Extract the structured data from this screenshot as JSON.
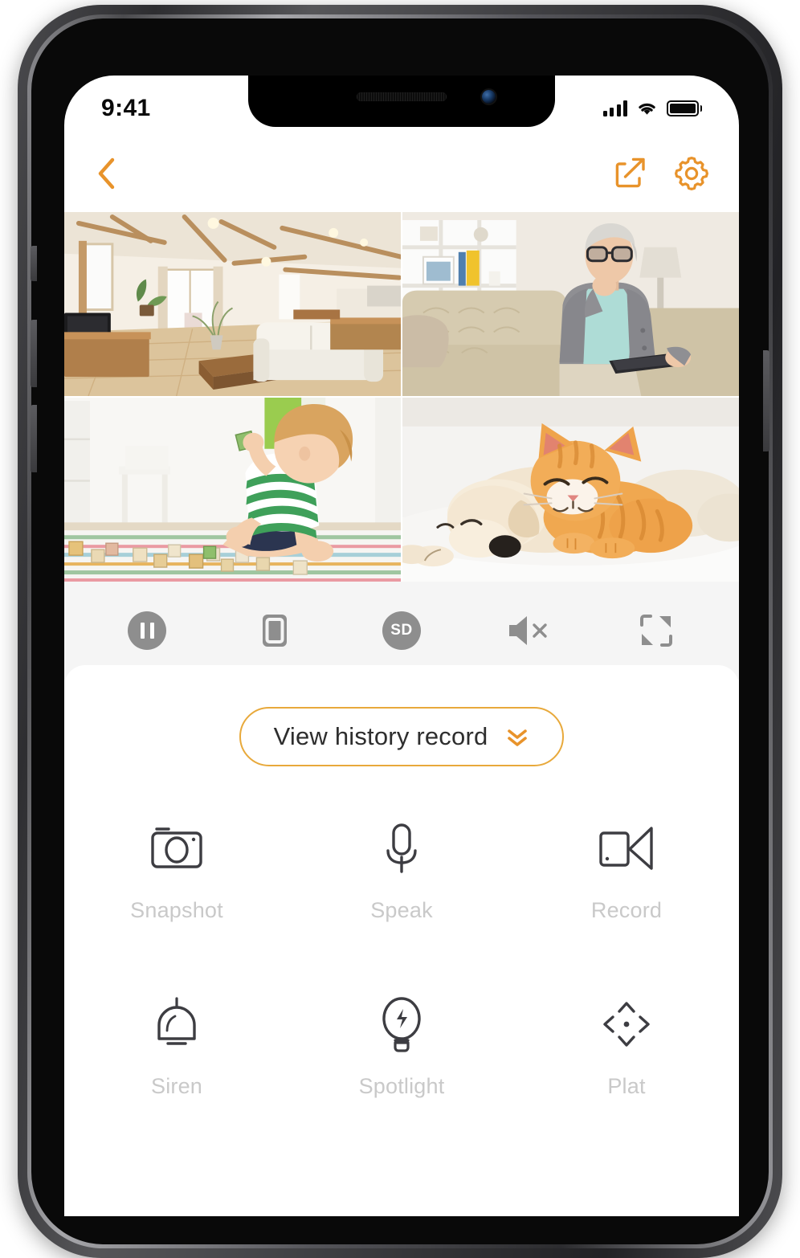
{
  "status_bar": {
    "time": "9:41",
    "signal_icon": "cellular-signal-icon",
    "wifi_icon": "wifi-icon",
    "battery_icon": "battery-full-icon"
  },
  "nav_bar": {
    "back_icon": "chevron-left-icon",
    "share_icon": "share-icon",
    "settings_icon": "gear-icon",
    "accent_color": "#e8932b"
  },
  "video_grid": {
    "tiles": [
      {
        "name": "camera-living-room",
        "caption": "Living room with wooden ceiling beams, sofa and TV"
      },
      {
        "name": "camera-lounge",
        "caption": "Elderly man sitting on sofa holding a tablet"
      },
      {
        "name": "camera-playroom",
        "caption": "Toddler in green striped shirt playing with wooden blocks"
      },
      {
        "name": "camera-pet-area",
        "caption": "Puppy and ginger kitten sleeping together on a rug"
      }
    ]
  },
  "control_bar": {
    "buttons": [
      {
        "name": "pause-button",
        "icon": "pause-icon",
        "label": ""
      },
      {
        "name": "screen-layout-button",
        "icon": "square-in-square-icon",
        "label": ""
      },
      {
        "name": "quality-button",
        "icon": "sd-badge-icon",
        "label": "SD"
      },
      {
        "name": "mute-button",
        "icon": "speaker-muted-icon",
        "label": ""
      },
      {
        "name": "fullscreen-button",
        "icon": "fullscreen-expand-icon",
        "label": ""
      }
    ],
    "background_color": "#f5f5f5",
    "icon_color": "#8e8e8e"
  },
  "history": {
    "label": "View  history record",
    "chevron_icon": "double-chevron-down-icon",
    "border_color": "#e8a93b"
  },
  "actions": [
    {
      "name": "snapshot",
      "label": "Snapshot",
      "icon": "camera-icon"
    },
    {
      "name": "speak",
      "label": "Speak",
      "icon": "microphone-icon"
    },
    {
      "name": "record",
      "label": "Record",
      "icon": "video-camera-icon"
    },
    {
      "name": "siren",
      "label": "Siren",
      "icon": "bell-icon"
    },
    {
      "name": "spotlight",
      "label": "Spotlight",
      "icon": "light-bulb-icon"
    },
    {
      "name": "plat",
      "label": "Plat",
      "icon": "pan-tilt-icon"
    }
  ]
}
